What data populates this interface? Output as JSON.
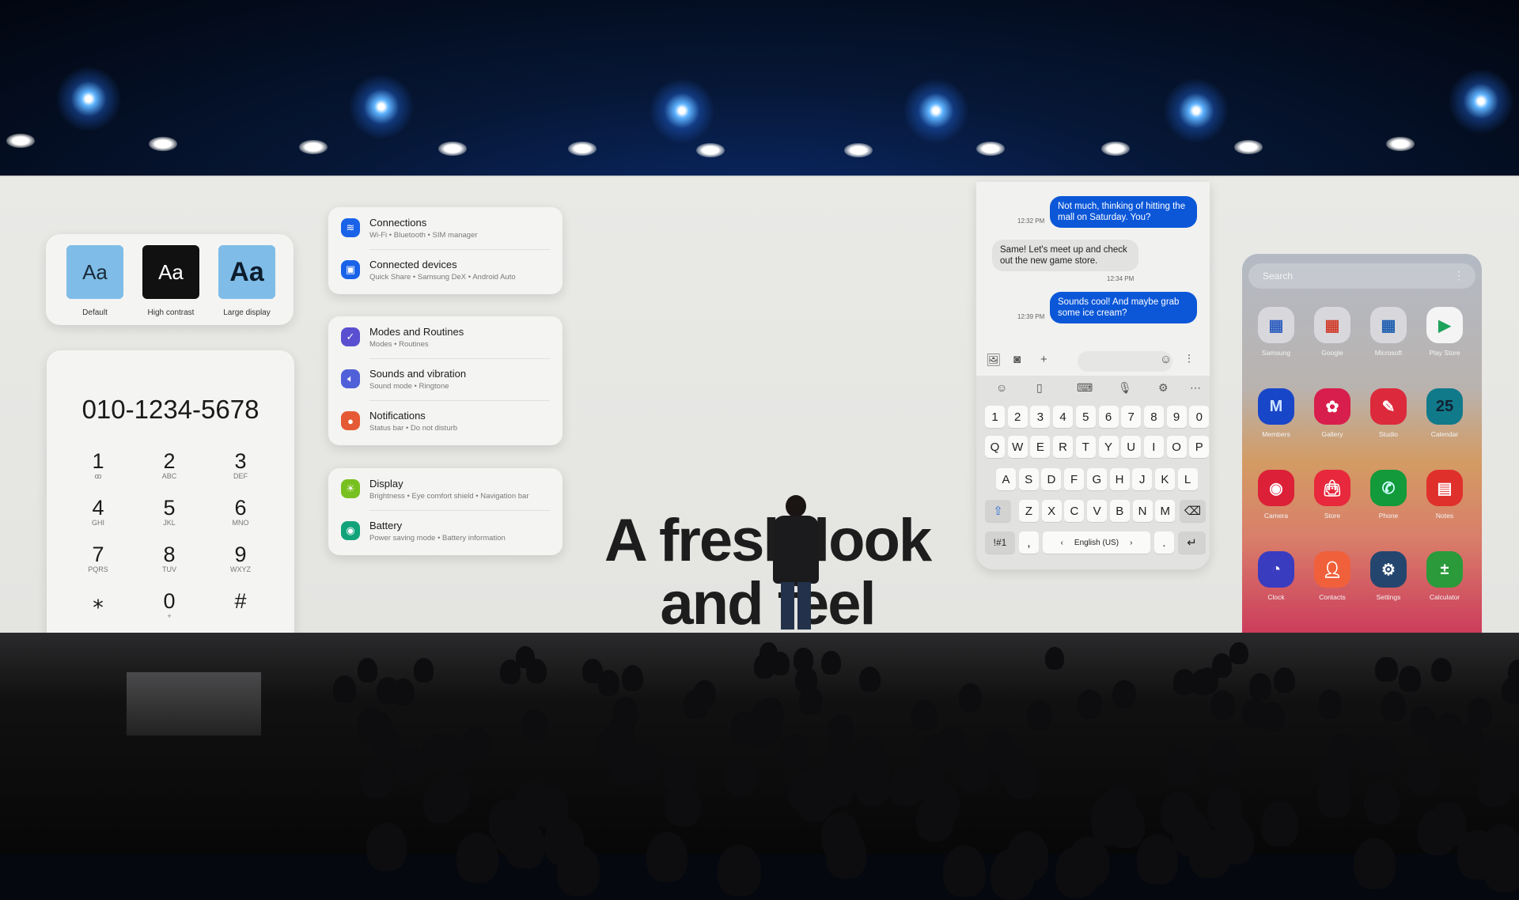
{
  "headline": {
    "line1": "A fresh look",
    "line2": "and feel"
  },
  "accessibility": {
    "options": [
      {
        "glyph": "Aa",
        "label": "Default",
        "bg": "#7fbde8",
        "fg": "#1a2a3a"
      },
      {
        "glyph": "Aa",
        "label": "High contrast",
        "bg": "#111111",
        "fg": "#ffffff"
      },
      {
        "glyph": "Aa",
        "label": "Large display",
        "bg": "#7fbde8",
        "fg": "#0d1d2d"
      }
    ]
  },
  "dialer": {
    "number": "010-1234-5678",
    "keys": [
      {
        "n": "1",
        "l": "ꝏ"
      },
      {
        "n": "2",
        "l": "ABC"
      },
      {
        "n": "3",
        "l": "DEF"
      },
      {
        "n": "4",
        "l": "GHI"
      },
      {
        "n": "5",
        "l": "JKL"
      },
      {
        "n": "6",
        "l": "MNO"
      },
      {
        "n": "7",
        "l": "PQRS"
      },
      {
        "n": "8",
        "l": "TUV"
      },
      {
        "n": "9",
        "l": "WXYZ"
      },
      {
        "n": "⁎",
        "l": ""
      },
      {
        "n": "0",
        "l": "+"
      },
      {
        "n": "#",
        "l": ""
      }
    ]
  },
  "settings": {
    "groups": [
      [
        {
          "title": "Connections",
          "sub": "Wi-Fi  •  Bluetooth  •  SIM manager",
          "icon": "wifi-icon",
          "glyph": "≋",
          "color": "#1a62e8"
        },
        {
          "title": "Connected devices",
          "sub": "Quick Share  •  Samsung DeX  •  Android Auto",
          "icon": "devices-icon",
          "glyph": "▣",
          "color": "#1a62e8"
        }
      ],
      [
        {
          "title": "Modes and Routines",
          "sub": "Modes  •  Routines",
          "icon": "routines-icon",
          "glyph": "✓",
          "color": "#5a4fd0"
        },
        {
          "title": "Sounds and vibration",
          "sub": "Sound mode  •  Ringtone",
          "icon": "sound-icon",
          "glyph": "🔈︎",
          "color": "#5060d8"
        },
        {
          "title": "Notifications",
          "sub": "Status bar  •  Do not disturb",
          "icon": "notifications-icon",
          "glyph": "●",
          "color": "#e55a34"
        }
      ],
      [
        {
          "title": "Display",
          "sub": "Brightness  •  Eye comfort shield  •  Navigation bar",
          "icon": "display-icon",
          "glyph": "☀",
          "color": "#78c020"
        },
        {
          "title": "Battery",
          "sub": "Power saving mode  •  Battery information",
          "icon": "battery-icon",
          "glyph": "◉",
          "color": "#12a37a"
        }
      ]
    ]
  },
  "messages": [
    {
      "dir": "out",
      "text": "Not much, thinking of hitting the mall on Saturday. You?",
      "time": "12:32 PM"
    },
    {
      "dir": "in",
      "text": "Same! Let's meet up and check out the new game store.",
      "time": "12:34 PM"
    },
    {
      "dir": "out",
      "text": "Sounds cool! And maybe grab some ice cream?",
      "time": "12:39 PM"
    }
  ],
  "keyboard": {
    "rows": [
      [
        "1",
        "2",
        "3",
        "4",
        "5",
        "6",
        "7",
        "8",
        "9",
        "0"
      ],
      [
        "Q",
        "W",
        "E",
        "R",
        "T",
        "Y",
        "U",
        "I",
        "O",
        "P"
      ],
      [
        "A",
        "S",
        "D",
        "F",
        "G",
        "H",
        "J",
        "K",
        "L"
      ],
      [
        "Z",
        "X",
        "C",
        "V",
        "B",
        "N",
        "M"
      ]
    ],
    "symbols_key": "!#1",
    "comma": ",",
    "period": ".",
    "language": "English (US)",
    "shift": "⇧",
    "backspace": "⌫",
    "enter": "↵",
    "lang_prev": "‹",
    "lang_next": "›",
    "compose_icons": [
      {
        "name": "gallery-icon",
        "g": "🖼︎"
      },
      {
        "name": "camera-icon",
        "g": "◙"
      },
      {
        "name": "plus-icon",
        "g": "+"
      },
      {
        "name": "emoji-icon",
        "g": "☺"
      },
      {
        "name": "voice-wave-icon",
        "g": "⫶"
      }
    ],
    "toolbar_icons": [
      {
        "name": "emoji-icon",
        "g": "☺"
      },
      {
        "name": "clipboard-icon",
        "g": "▯"
      },
      {
        "name": "keyboard-mode-icon",
        "g": "⌨"
      },
      {
        "name": "mic-icon",
        "g": "🎙︎"
      },
      {
        "name": "settings-icon",
        "g": "⚙"
      },
      {
        "name": "more-icon",
        "g": "⋯"
      }
    ]
  },
  "app_drawer": {
    "search_placeholder": "Search",
    "menu": "⋮",
    "apps": [
      {
        "label": "Samsung",
        "bg": "#d8d8dc",
        "g": "▦",
        "fg": "#3060c0"
      },
      {
        "label": "Google",
        "bg": "#d8d8dc",
        "g": "▦",
        "fg": "#d04030"
      },
      {
        "label": "Microsoft",
        "bg": "#d8d8dc",
        "g": "▦",
        "fg": "#2060b0"
      },
      {
        "label": "Play Store",
        "bg": "#f4f4f4",
        "g": "▶",
        "fg": "#1fa35c"
      },
      {
        "label": "Members",
        "bg": "#1846c8",
        "g": "M",
        "fg": "#cfe4ff"
      },
      {
        "label": "Gallery",
        "bg": "#d81e4c",
        "g": "✿",
        "fg": "#fff"
      },
      {
        "label": "Studio",
        "bg": "#dc2a3c",
        "g": "✎",
        "fg": "#fff"
      },
      {
        "label": "Calendar",
        "bg": "#117a8a",
        "g": "25",
        "fg": "#123"
      },
      {
        "label": "Camera",
        "bg": "#dc2038",
        "g": "◉",
        "fg": "#fff"
      },
      {
        "label": "Store",
        "bg": "#e8283c",
        "g": "👜︎",
        "fg": "#fff"
      },
      {
        "label": "Phone",
        "bg": "#139a3a",
        "g": "✆",
        "fg": "#cff"
      },
      {
        "label": "Notes",
        "bg": "#e0302c",
        "g": "▤",
        "fg": "#fff"
      },
      {
        "label": "Clock",
        "bg": "#3a3cc0",
        "g": "◔",
        "fg": "#fff"
      },
      {
        "label": "Contacts",
        "bg": "#f0603a",
        "g": "👤︎",
        "fg": "#fff"
      },
      {
        "label": "Settings",
        "bg": "#24466e",
        "g": "⚙",
        "fg": "#fff"
      },
      {
        "label": "Calculator",
        "bg": "#2a9a3a",
        "g": "±",
        "fg": "#fff"
      }
    ]
  }
}
